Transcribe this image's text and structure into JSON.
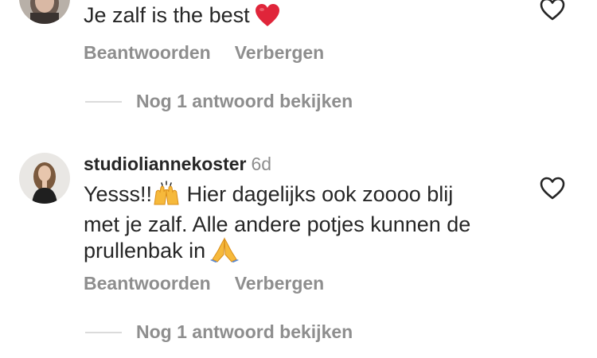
{
  "comments": [
    {
      "text": "Je zalf is the best",
      "emoji_icon": "red-heart-icon",
      "reply_label": "Beantwoorden",
      "hide_label": "Verbergen",
      "view_replies_label": "Nog 1 antwoord bekijken"
    },
    {
      "username": "studioliannekoster",
      "time": "6d",
      "text_part1": "Yesss!!",
      "emoji1_icon": "raising-hands-icon",
      "text_part2": " Hier dagelijks ook zoooo blij",
      "text_line2": "met je zalf. Alle andere potjes kunnen de",
      "text_line3": "prullenbak in",
      "emoji2_icon": "folded-hands-icon",
      "reply_label": "Beantwoorden",
      "hide_label": "Verbergen",
      "view_replies_label": "Nog 1 antwoord bekijken"
    }
  ],
  "colors": {
    "text": "#262626",
    "secondary": "#8e8e8e",
    "heart": "#e0245e"
  }
}
